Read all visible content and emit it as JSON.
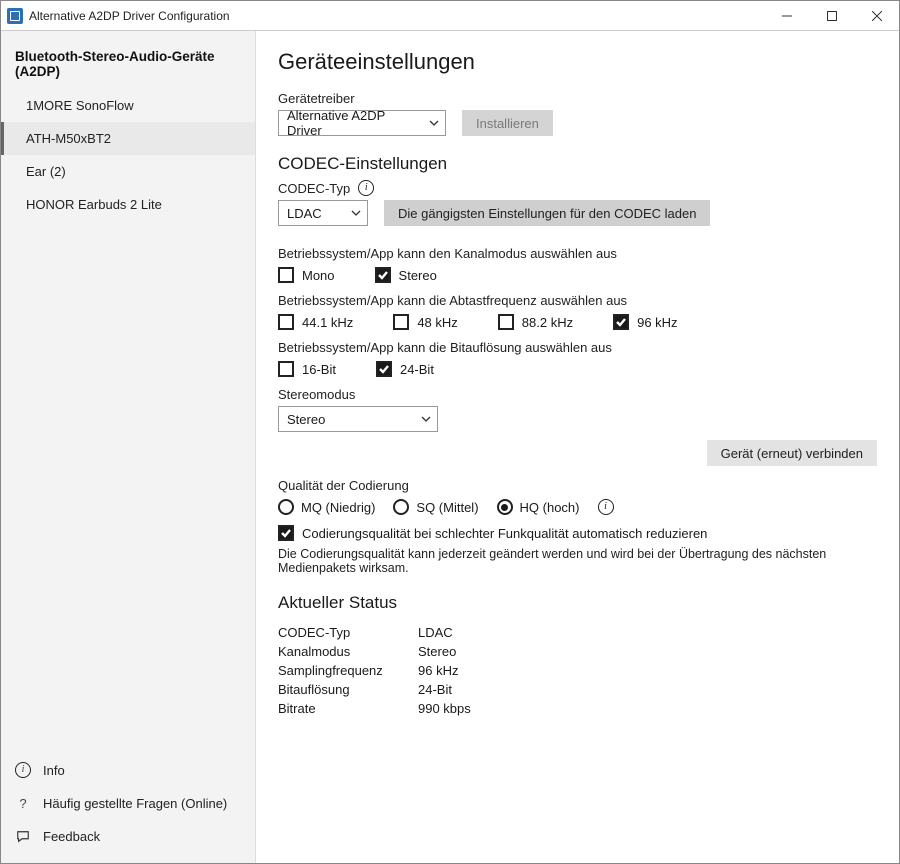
{
  "window": {
    "title": "Alternative A2DP Driver Configuration"
  },
  "sidebar": {
    "header": "Bluetooth-Stereo-Audio-Geräte (A2DP)",
    "devices": [
      {
        "label": "1MORE SonoFlow"
      },
      {
        "label": "ATH-M50xBT2"
      },
      {
        "label": "Ear (2)"
      },
      {
        "label": "HONOR Earbuds 2 Lite"
      }
    ],
    "bottom": [
      {
        "label": "Info"
      },
      {
        "label": "Häufig gestellte Fragen (Online)"
      },
      {
        "label": "Feedback"
      }
    ]
  },
  "settings": {
    "page_title": "Geräteeinstellungen",
    "driver_label": "Gerätetreiber",
    "driver_value": "Alternative A2DP Driver",
    "install_button": "Installieren",
    "codec_heading": "CODEC-Einstellungen",
    "codec_type_label": "CODEC-Typ",
    "codec_type_value": "LDAC",
    "load_defaults_button": "Die gängigsten Einstellungen für den CODEC laden",
    "channel_mode_label": "Betriebssystem/App kann den Kanalmodus auswählen aus",
    "channel_options": {
      "mono": "Mono",
      "stereo": "Stereo"
    },
    "sample_rate_label": "Betriebssystem/App kann die Abtastfrequenz auswählen aus",
    "sample_options": {
      "r44": "44.1 kHz",
      "r48": "48 kHz",
      "r88": "88.2 kHz",
      "r96": "96 kHz"
    },
    "bit_depth_label": "Betriebssystem/App kann die Bitauflösung auswählen aus",
    "bit_options": {
      "b16": "16-Bit",
      "b24": "24-Bit"
    },
    "stereo_mode_label": "Stereomodus",
    "stereo_mode_value": "Stereo",
    "reconnect_button": "Gerät (erneut) verbinden",
    "quality_label": "Qualität der Codierung",
    "quality_options": {
      "mq": "MQ (Niedrig)",
      "sq": "SQ (Mittel)",
      "hq": "HQ (hoch)"
    },
    "auto_reduce_label": "Codierungsqualität bei schlechter Funkqualität automatisch reduzieren",
    "quality_note": "Die Codierungsqualität kann jederzeit geändert werden und wird bei der Übertragung des nächsten Medienpakets wirksam."
  },
  "status": {
    "heading": "Aktueller Status",
    "rows": {
      "codec_k": "CODEC-Typ",
      "codec_v": "LDAC",
      "chan_k": "Kanalmodus",
      "chan_v": "Stereo",
      "rate_k": "Samplingfrequenz",
      "rate_v": "96 kHz",
      "bits_k": "Bitauflösung",
      "bits_v": "24-Bit",
      "bitrate_k": "Bitrate",
      "bitrate_v": "990 kbps"
    }
  }
}
